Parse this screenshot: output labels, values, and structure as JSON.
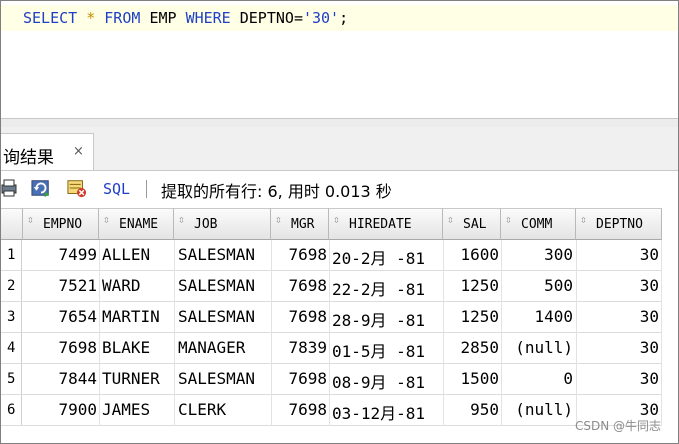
{
  "editor": {
    "tokens": {
      "select": "SELECT",
      "star": "*",
      "from": "FROM",
      "table": "EMP",
      "where": "WHERE",
      "column": "DEPTNO",
      "eq": "=",
      "value": "'30'",
      "semi": ";"
    }
  },
  "tab": {
    "label": "询结果",
    "close": "×"
  },
  "toolbar": {
    "sql_label": "SQL",
    "status": "提取的所有行: 6, 用时 0.013 秒"
  },
  "grid": {
    "columns": [
      "EMPNO",
      "ENAME",
      "JOB",
      "MGR",
      "HIREDATE",
      "SAL",
      "COMM",
      "DEPTNO"
    ],
    "rows": [
      [
        "1",
        "7499",
        "ALLEN",
        "SALESMAN",
        "7698",
        "20-2月 -81",
        "1600",
        "300",
        "30"
      ],
      [
        "2",
        "7521",
        "WARD",
        "SALESMAN",
        "7698",
        "22-2月 -81",
        "1250",
        "500",
        "30"
      ],
      [
        "3",
        "7654",
        "MARTIN",
        "SALESMAN",
        "7698",
        "28-9月 -81",
        "1250",
        "1400",
        "30"
      ],
      [
        "4",
        "7698",
        "BLAKE",
        "MANAGER",
        "7839",
        "01-5月 -81",
        "2850",
        "(null)",
        "30"
      ],
      [
        "5",
        "7844",
        "TURNER",
        "SALESMAN",
        "7698",
        "08-9月 -81",
        "1500",
        "0",
        "30"
      ],
      [
        "6",
        "7900",
        "JAMES",
        "CLERK",
        "7698",
        "03-12月-81",
        "950",
        "(null)",
        "30"
      ]
    ]
  },
  "watermark": "CSDN @牛同志",
  "colors": {
    "keyword": "#1f3fc6",
    "current_line": "#ffffe6",
    "operator": "#c48f00"
  },
  "icons": [
    "print-icon",
    "refresh-icon",
    "export-icon"
  ]
}
